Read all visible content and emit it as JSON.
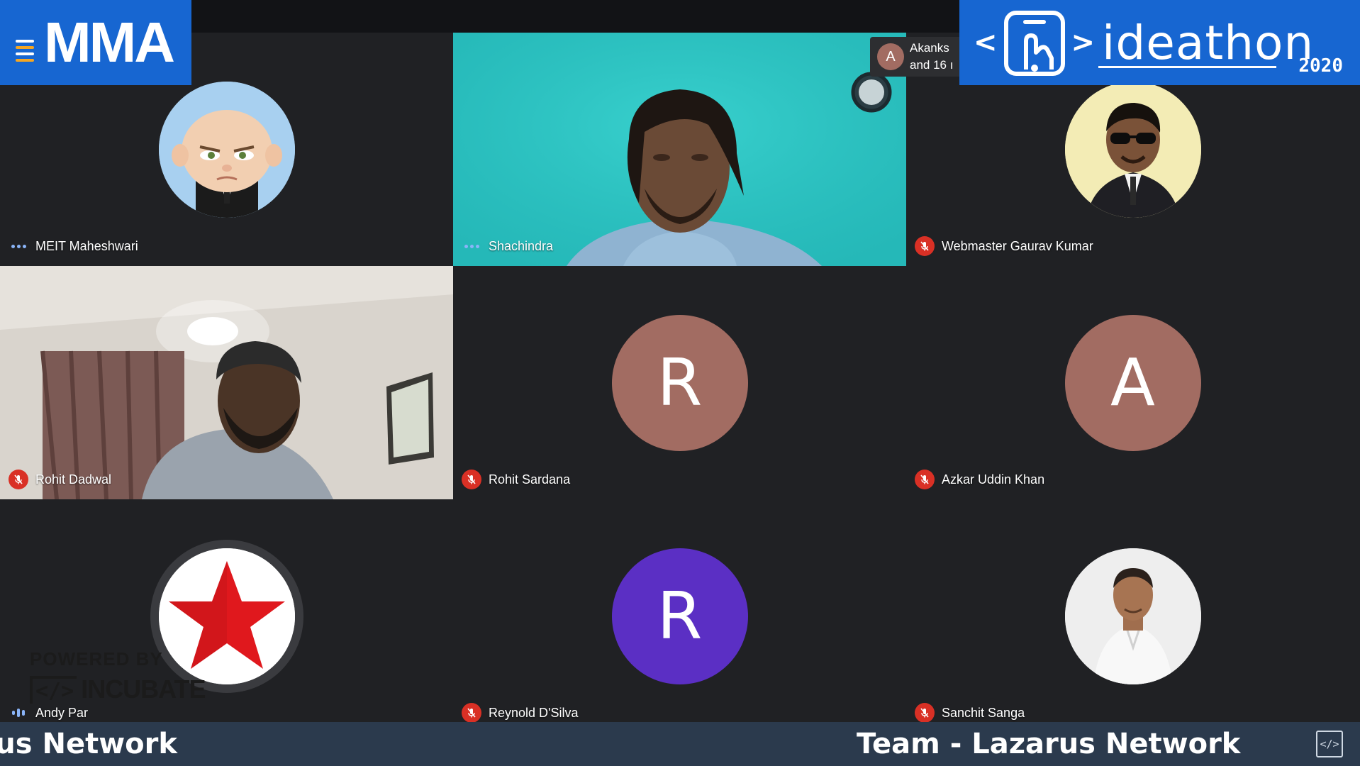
{
  "branding": {
    "left_logo": "MMA",
    "right_logo_title": "ideathon",
    "right_logo_year": "2020",
    "right_logo_chevron_left": "<",
    "right_logo_chevron_right": ">"
  },
  "others_chip": {
    "avatar_letter": "A",
    "line1": "Akanks",
    "line2": "and 16 ı"
  },
  "participants": [
    {
      "name": "MEIT Maheshwari",
      "status": "dots",
      "avatar_type": "photo",
      "avatar_icon": "baby-boss-avatar-icon"
    },
    {
      "name": "Shachindra",
      "status": "dots",
      "avatar_type": "video"
    },
    {
      "name": "Webmaster Gaurav Kumar",
      "status": "muted",
      "avatar_type": "photo",
      "avatar_icon": "man-sunglasses-avatar-icon"
    },
    {
      "name": "Rohit Dadwal",
      "status": "muted",
      "avatar_type": "video"
    },
    {
      "name": "Rohit Sardana",
      "status": "muted",
      "avatar_type": "letter",
      "letter": "R",
      "color": "#a26c62"
    },
    {
      "name": "Azkar Uddin Khan",
      "status": "muted",
      "avatar_type": "letter",
      "letter": "A",
      "color": "#a26c62"
    },
    {
      "name": "Andy Par",
      "status": "speaking",
      "avatar_type": "photo",
      "avatar_icon": "red-star-avatar-icon"
    },
    {
      "name": "Reynold D'Silva",
      "status": "muted",
      "avatar_type": "letter",
      "letter": "R",
      "color": "#5b2fc4"
    },
    {
      "name": "Sanchit Sanga",
      "status": "muted",
      "avatar_type": "photo",
      "avatar_icon": "man-white-shirt-avatar-icon"
    }
  ],
  "powered_by": {
    "label": "POWERED BY",
    "code_glyph": "</>",
    "brand": "INCUBATE"
  },
  "ticker": {
    "text_left": "rus Network",
    "text_right": "Team - Lazarus Network",
    "embed_glyph": "</>"
  },
  "colors": {
    "brand_blue": "#1766d1",
    "muted_red": "#d93025",
    "speaking_blue": "#8ab4f8",
    "ticker_bg": "#2b3a4d",
    "tile_bg": "#202124"
  }
}
